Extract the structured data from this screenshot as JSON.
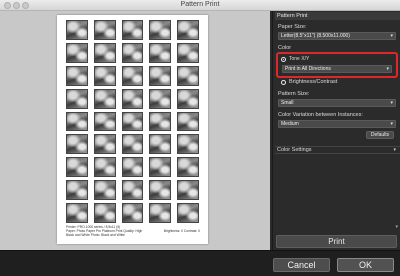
{
  "window": {
    "title": "Pattern Print"
  },
  "panel": {
    "header": "Pattern Print",
    "paper_size_label": "Paper Size:",
    "paper_size_value": "Letter(8.5\"x11\") (8.500x11.000)",
    "color_label": "Color",
    "tone_option": "Tone X/Y",
    "tone_selected": true,
    "direction_value": "Print in All Directions",
    "brightness_option": "Brightness/Contrast",
    "pattern_size_label": "Pattern Size:",
    "pattern_size_value": "Small",
    "variation_label": "Color Variation between Instances:",
    "variation_value": "Medium",
    "defaults_label": "Defaults",
    "color_settings_label": "Color Settings",
    "print_label": "Print"
  },
  "paper": {
    "info_line1": "Printer: PRO-1000 series / 8.5x11 (5)",
    "info_line2": "Paper: Photo Paper Pro Platinum  Print Quality: High",
    "info_line3": "Black and White Photo: Black and White",
    "brightness_contrast": "Brightness: 0  Contrast: 0",
    "tiles": 45
  },
  "footer": {
    "cancel_label": "Cancel",
    "ok_label": "OK"
  },
  "colors": {
    "highlight": "#e0262d",
    "panel_bg": "#2b2b2b"
  }
}
